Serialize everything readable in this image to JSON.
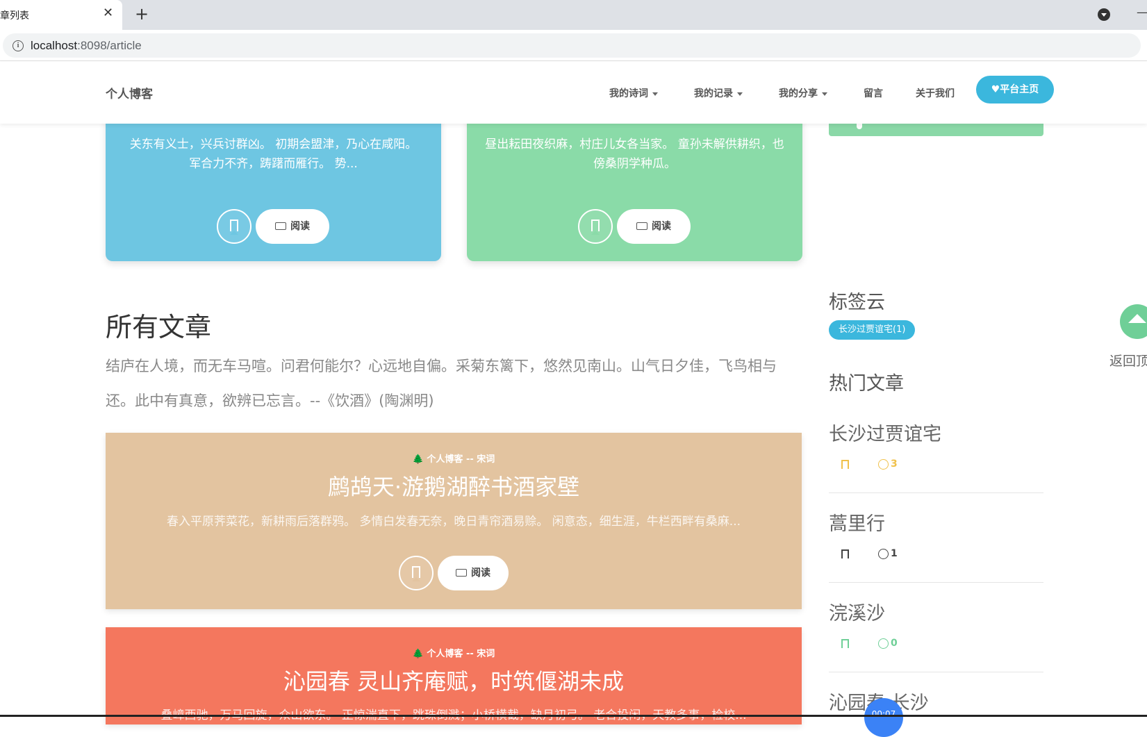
{
  "browser": {
    "tab_title": "文章列表",
    "tab_close": "✕",
    "new_tab": "+",
    "window_min": "—",
    "url_host": "localhost",
    "url_rest": ":8098/article",
    "info_glyph": "i"
  },
  "header": {
    "brand": "个人博客",
    "nav": [
      {
        "label": "我的诗词",
        "dropdown": true
      },
      {
        "label": "我的记录",
        "dropdown": true
      },
      {
        "label": "我的分享",
        "dropdown": true
      },
      {
        "label": "留言",
        "dropdown": false
      },
      {
        "label": "关于我们",
        "dropdown": false
      }
    ],
    "platform_button": "♥平台主页",
    "accent": "#3bb7dd"
  },
  "top_cards": [
    {
      "excerpt": "关东有义士，兴兵讨群凶。 初期会盟津，乃心在咸阳。 军合力不齐，踌躇而雁行。 势...",
      "color": "#6ec6e2",
      "read_label": "阅读"
    },
    {
      "excerpt": "昼出耘田夜织麻，村庄儿女各当家。 童孙未解供耕织，也傍桑阴学种瓜。",
      "color": "#8adba8",
      "read_label": "阅读"
    }
  ],
  "section": {
    "title": "所有文章",
    "quote": "结庐在人境，而无车马喧。问君何能尔？心远地自偏。采菊东篱下，悠然见南山。山气日夕佳，飞鸟相与还。此中有真意，欲辨已忘言。--《饮酒》(陶渊明)"
  },
  "articles": [
    {
      "meta": "🌲 个人博客 -- 宋词",
      "title": "鹧鸪天·游鹅湖醉书酒家壁",
      "excerpt": "春入平原荠菜花，新耕雨后落群鸦。 多情白发春无奈，晚日青帘酒易赊。 闲意态，细生涯，牛栏西畔有桑麻...",
      "color": "#e3c4a0",
      "read_label": "阅读"
    },
    {
      "meta": "🌲 个人博客 -- 宋词",
      "title": "沁园春 灵山齐庵赋，时筑偃湖未成",
      "excerpt": "叠嶂西驰，万马回旋，众山欲东。 正惊湍直下，跳珠倒溅；小桥横截，缺月初弓。 老合投闲，天教多事，检校...",
      "color": "#f4775e"
    }
  ],
  "sidebar": {
    "tag_cloud_title": "标签云",
    "tags": [
      "长沙过贾谊宅(1)"
    ],
    "hot_title": "热门文章",
    "hot": [
      {
        "title": "长沙过贾谊宅",
        "count": "3",
        "color": "#f0c14b"
      },
      {
        "title": "蒿里行",
        "count": "1",
        "color": "#444444"
      },
      {
        "title": "浣溪沙",
        "count": "0",
        "color": "#6fcf97"
      },
      {
        "title": "沁园春 长沙",
        "count": "",
        "color": "#444444"
      }
    ]
  },
  "totop_label": "返回顶部",
  "timer": "00:07"
}
